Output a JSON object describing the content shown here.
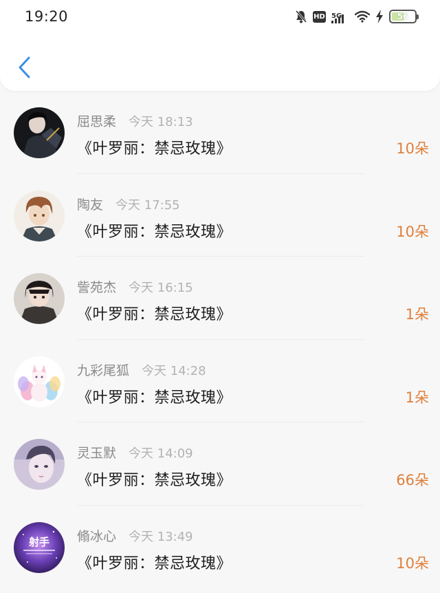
{
  "status_bar": {
    "time": "19:20",
    "icons": [
      "bell-muted-icon",
      "hd-icon",
      "5g-signal-icon",
      "wifi-icon",
      "charging-icon",
      "battery-icon"
    ],
    "network_label": "5G",
    "hd_label": "HD",
    "battery_label": "56",
    "battery_level": 0.56
  },
  "nav": {
    "back_icon": "chevron-left-icon",
    "accent_color": "#3a8ee6"
  },
  "colors": {
    "count": "#e07f3a",
    "username": "#8a8a8a",
    "timestamp": "#b2b2b2"
  },
  "entries": [
    {
      "username": "屈思柔",
      "time": "今天 18:13",
      "title": "《叶罗丽：禁忌玫瑰》",
      "count": "10朵"
    },
    {
      "username": "陶友",
      "time": "今天 17:55",
      "title": "《叶罗丽：禁忌玫瑰》",
      "count": "10朵"
    },
    {
      "username": "訾苑杰",
      "time": "今天 16:15",
      "title": "《叶罗丽：禁忌玫瑰》",
      "count": "1朵"
    },
    {
      "username": "九彩尾狐",
      "time": "今天 14:28",
      "title": "《叶罗丽：禁忌玫瑰》",
      "count": "1朵"
    },
    {
      "username": "灵玉默",
      "time": "今天 14:09",
      "title": "《叶罗丽：禁忌玫瑰》",
      "count": "66朵"
    },
    {
      "username": "翛冰心",
      "time": "今天 13:49",
      "title": "《叶罗丽：禁忌玫瑰》",
      "count": "10朵"
    }
  ]
}
